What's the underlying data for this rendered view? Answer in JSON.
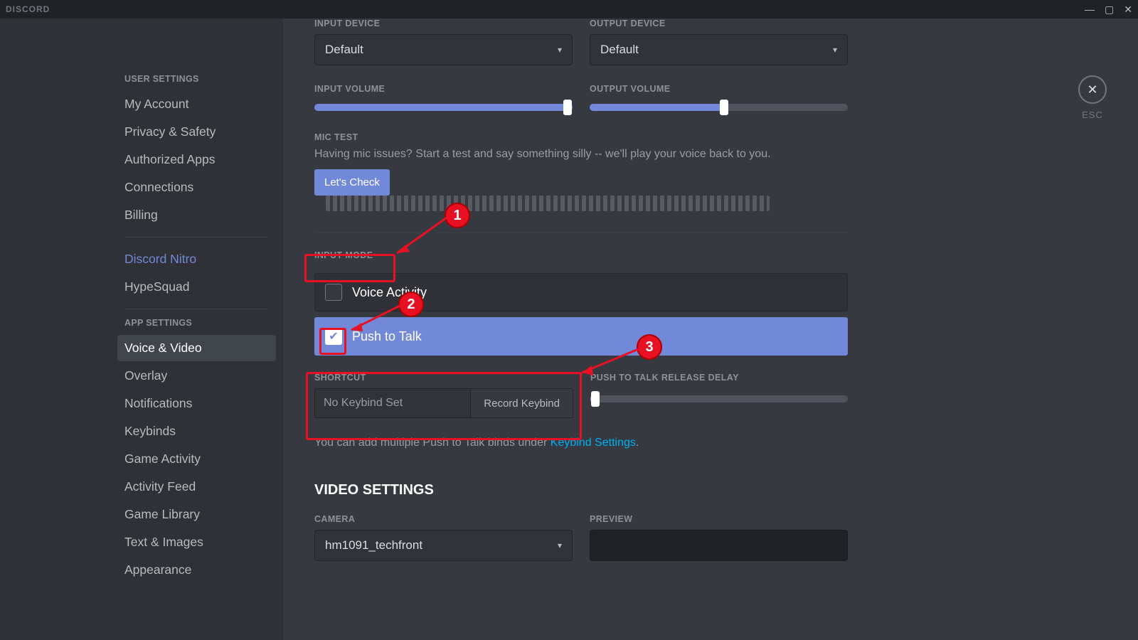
{
  "brand": "DISCORD",
  "close_label": "ESC",
  "sidebar": {
    "cat_user": "USER SETTINGS",
    "cat_app": "APP SETTINGS",
    "items_user": [
      "My Account",
      "Privacy & Safety",
      "Authorized Apps",
      "Connections",
      "Billing"
    ],
    "items_nitro": [
      "Discord Nitro",
      "HypeSquad"
    ],
    "items_app": [
      "Voice & Video",
      "Overlay",
      "Notifications",
      "Keybinds",
      "Game Activity",
      "Activity Feed",
      "Game Library",
      "Text & Images",
      "Appearance"
    ]
  },
  "voice": {
    "input_device_label": "INPUT DEVICE",
    "output_device_label": "OUTPUT DEVICE",
    "input_device_value": "Default",
    "output_device_value": "Default",
    "input_volume_label": "INPUT VOLUME",
    "output_volume_label": "OUTPUT VOLUME",
    "input_volume_pct": 100,
    "output_volume_pct": 52,
    "mic_test_label": "MIC TEST",
    "mic_test_help": "Having mic issues? Start a test and say something silly -- we'll play your voice back to you.",
    "mic_test_button": "Let's Check",
    "input_mode_label": "INPUT MODE",
    "mode_voice_activity": "Voice Activity",
    "mode_push_to_talk": "Push to Talk",
    "shortcut_label": "SHORTCUT",
    "shortcut_value": "No Keybind Set",
    "shortcut_record": "Record Keybind",
    "ptt_delay_label": "PUSH TO TALK RELEASE DELAY",
    "ptt_delay_pct": 2,
    "hint_prefix": "You can add multiple Push to Talk binds under ",
    "hint_link": "Keybind Settings",
    "video_settings_label": "VIDEO SETTINGS",
    "camera_label": "CAMERA",
    "camera_value": "hm1091_techfront",
    "preview_label": "PREVIEW"
  },
  "annotations": {
    "b1": "1",
    "b2": "2",
    "b3": "3"
  }
}
